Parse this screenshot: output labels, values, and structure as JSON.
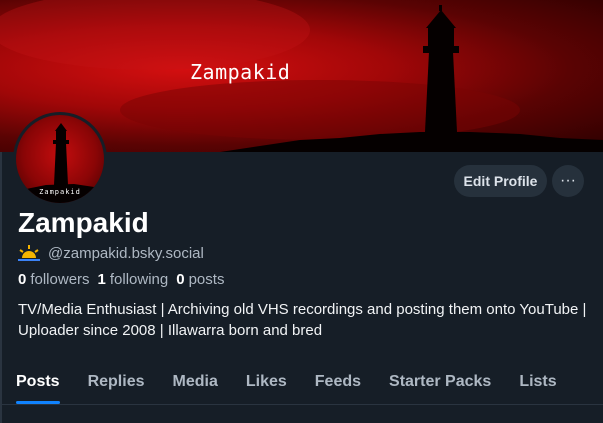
{
  "profile": {
    "banner_text": "Zampakid",
    "avatar_text": "Zampakid",
    "display_name": "Zampakid",
    "handle": "@zampakid.bsky.social",
    "bio": "TV/Media Enthusiast | Archiving old VHS recordings and posting them onto YouTube | Uploader since 2008 | Illawarra born and bred"
  },
  "stats": {
    "followers_count": "0",
    "followers_label": "followers",
    "following_count": "1",
    "following_label": "following",
    "posts_count": "0",
    "posts_label": "posts"
  },
  "actions": {
    "edit_label": "Edit Profile",
    "more_label": "···"
  },
  "tabs": [
    {
      "label": "Posts",
      "active": true
    },
    {
      "label": "Replies",
      "active": false
    },
    {
      "label": "Media",
      "active": false
    },
    {
      "label": "Likes",
      "active": false
    },
    {
      "label": "Feeds",
      "active": false
    },
    {
      "label": "Starter Packs",
      "active": false
    },
    {
      "label": "Lists",
      "active": false
    }
  ],
  "colors": {
    "background": "#161e27",
    "accent": "#1083fe",
    "banner_red": "#a10708",
    "button_bg": "#26313c"
  }
}
